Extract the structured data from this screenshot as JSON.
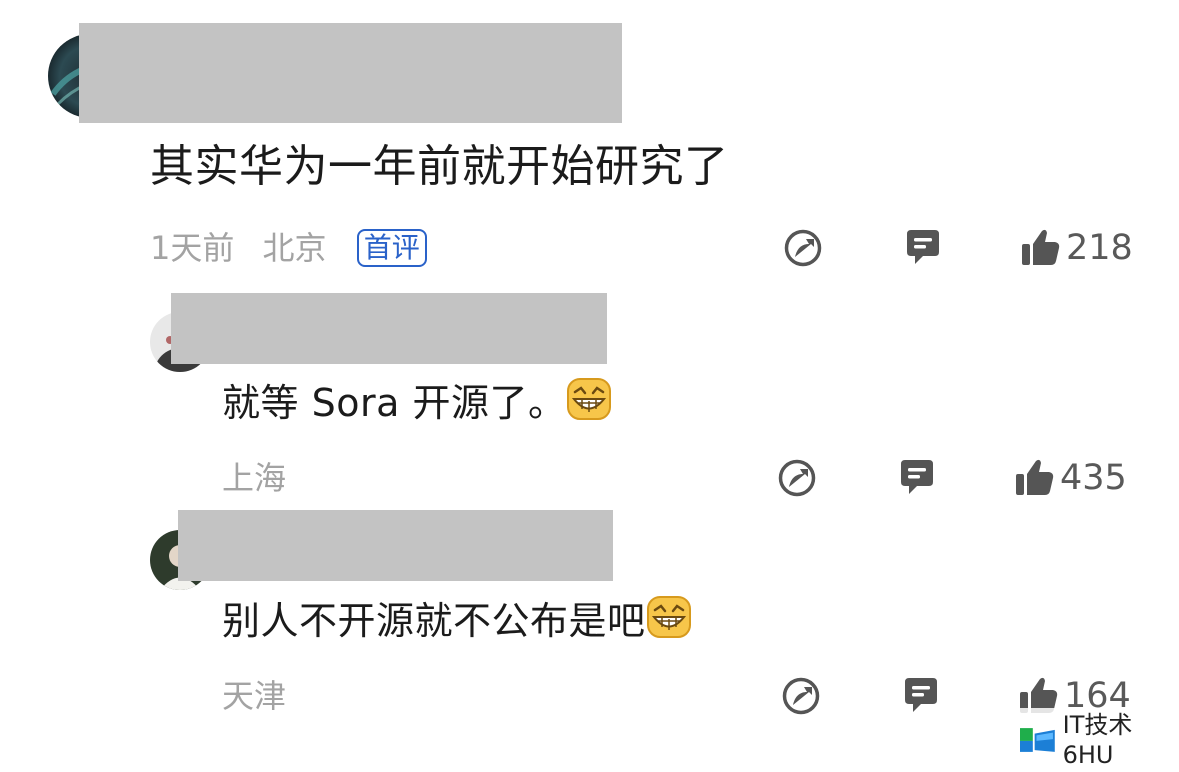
{
  "comments": [
    {
      "text": "其实华为一年前就开始研究了",
      "time": "1天前",
      "location": "北京",
      "badge": "首评",
      "likes": "218",
      "share_icon": "share-icon",
      "reply_icon": "comment-icon",
      "like_icon": "thumbs-up-icon"
    },
    {
      "text": "就等 Sora 开源了。",
      "emoji": "grinning-emoji",
      "location": "上海",
      "likes": "435",
      "share_icon": "share-icon",
      "reply_icon": "comment-icon",
      "like_icon": "thumbs-up-icon"
    },
    {
      "text": "别人不开源就不公布是吧",
      "emoji": "grinning-emoji",
      "location": "天津",
      "likes": "164",
      "share_icon": "share-icon",
      "reply_icon": "comment-icon",
      "like_icon": "thumbs-up-icon"
    }
  ],
  "watermark": {
    "text": "IT技术6HU",
    "logo": "watermark-logo"
  },
  "colors": {
    "meta_gray": "#a3a3a3",
    "badge_blue": "#2a62c9",
    "icon_gray": "#555555",
    "redaction": "#c3c3c3"
  }
}
